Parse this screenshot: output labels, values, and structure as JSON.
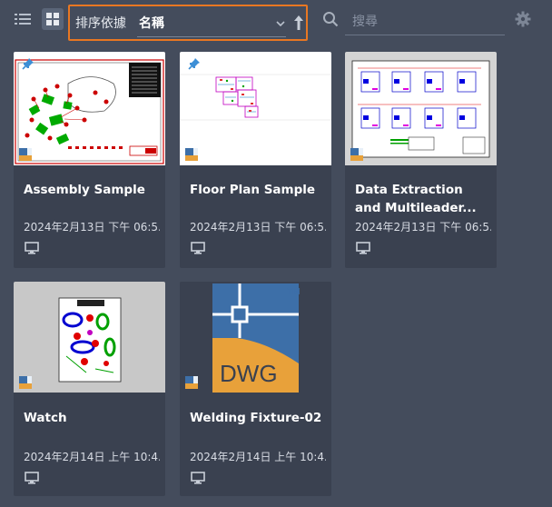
{
  "toolbar": {
    "sort_label": "排序依據",
    "sort_value": "名稱",
    "search_placeholder": "搜尋",
    "view_modes": [
      "list-view",
      "grid-view"
    ],
    "active_view": "grid-view",
    "accent_color": "#e87722"
  },
  "cards": [
    {
      "title": "Assembly Sample",
      "date": "2024年2月13日 下午 06:5...",
      "pinned": true,
      "location_icon": "monitor-icon"
    },
    {
      "title": "Floor Plan Sample",
      "date": "2024年2月13日 下午 06:5...",
      "pinned": true,
      "location_icon": "monitor-icon"
    },
    {
      "title": "Data Extraction and Multileader...",
      "date": "2024年2月13日 下午 06:5...",
      "pinned": false,
      "location_icon": "monitor-icon"
    },
    {
      "title": "Watch",
      "date": "2024年2月14日 上午 10:4...",
      "pinned": false,
      "location_icon": "monitor-icon"
    },
    {
      "title": "Welding Fixture-02",
      "date": "2024年2月14日 上午 10:4...",
      "pinned": false,
      "location_icon": "monitor-icon"
    }
  ],
  "dwg_logo_text": "DWG"
}
